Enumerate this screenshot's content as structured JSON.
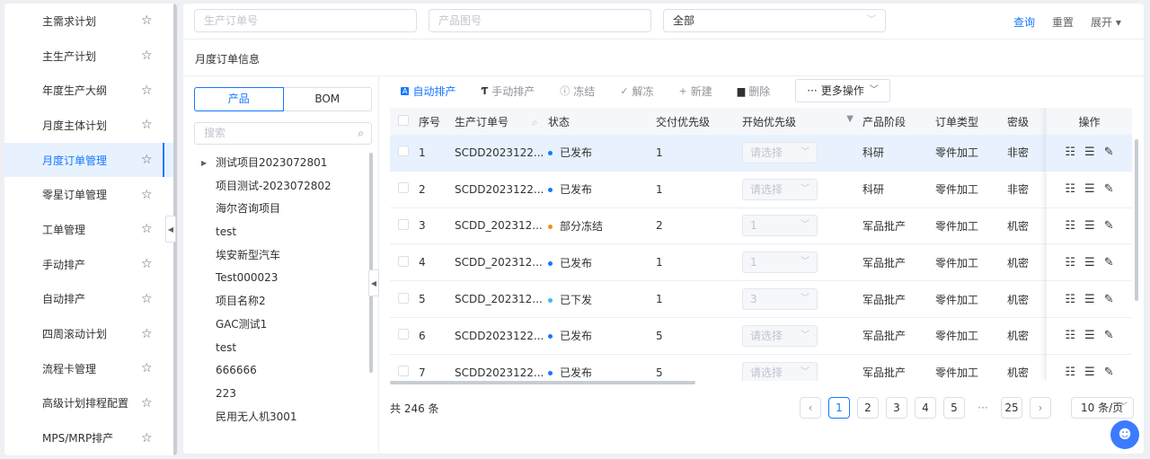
{
  "sidebar": {
    "items": [
      {
        "label": "主需求计划"
      },
      {
        "label": "主生产计划"
      },
      {
        "label": "年度生产大纲"
      },
      {
        "label": "月度主体计划"
      },
      {
        "label": "月度订单管理",
        "active": true
      },
      {
        "label": "零星订单管理"
      },
      {
        "label": "工单管理"
      },
      {
        "label": "手动排产"
      },
      {
        "label": "自动排产"
      },
      {
        "label": "四周滚动计划"
      },
      {
        "label": "流程卡管理"
      },
      {
        "label": "高级计划排程配置"
      },
      {
        "label": "MPS/MRP排产"
      }
    ],
    "star": "☆"
  },
  "filters": {
    "order_no_placeholder": "生产订单号",
    "drawing_no_placeholder": "产品图号",
    "status_select": "全部",
    "query": "查询",
    "reset": "重置",
    "expand": "展开 ▾"
  },
  "section_title": "月度订单信息",
  "tree": {
    "tabs": [
      "产品",
      "BOM"
    ],
    "search_placeholder": "搜索",
    "nodes": [
      "测试项目2023072801",
      "项目测试-2023072802",
      "海尔咨询项目",
      "test",
      "埃安新型汽车",
      "Test000023",
      "项目名称2",
      "GAC测试1",
      "test",
      "666666",
      "223",
      "民用无人机3001"
    ]
  },
  "toolbar": {
    "auto": "自动排产",
    "manual": "手动排产",
    "freeze": "冻结",
    "unfreeze": "解冻",
    "new": "新建",
    "delete": "删除",
    "more": "更多操作"
  },
  "table": {
    "headers": {
      "index": "序号",
      "order_no": "生产订单号",
      "status": "状态",
      "delivery_priority": "交付优先级",
      "start_priority": "开始优先级",
      "stage": "产品阶段",
      "order_type": "订单类型",
      "secrecy": "密级",
      "ops": "操作"
    },
    "rows": [
      {
        "index": "1",
        "order_no": "SCDD2023122...",
        "status": "已发布",
        "status_color": "#1677ff",
        "delivery": "1",
        "start": "请选择",
        "stage": "科研",
        "type": "零件加工",
        "secrecy": "非密"
      },
      {
        "index": "2",
        "order_no": "SCDD2023122...",
        "status": "已发布",
        "status_color": "#1677ff",
        "delivery": "1",
        "start": "请选择",
        "stage": "科研",
        "type": "零件加工",
        "secrecy": "非密"
      },
      {
        "index": "3",
        "order_no": "SCDD_202312...",
        "status": "部分冻结",
        "status_color": "#fa8c16",
        "delivery": "2",
        "start": "1",
        "stage": "军品批产",
        "type": "零件加工",
        "secrecy": "机密"
      },
      {
        "index": "4",
        "order_no": "SCDD_202312...",
        "status": "已发布",
        "status_color": "#1677ff",
        "delivery": "1",
        "start": "1",
        "stage": "军品批产",
        "type": "零件加工",
        "secrecy": "机密"
      },
      {
        "index": "5",
        "order_no": "SCDD_202312...",
        "status": "已下发",
        "status_color": "#4ab3f4",
        "delivery": "1",
        "start": "3",
        "stage": "军品批产",
        "type": "零件加工",
        "secrecy": "机密"
      },
      {
        "index": "6",
        "order_no": "SCDD2023122...",
        "status": "已发布",
        "status_color": "#1677ff",
        "delivery": "5",
        "start": "请选择",
        "stage": "军品批产",
        "type": "零件加工",
        "secrecy": "机密"
      },
      {
        "index": "7",
        "order_no": "SCDD2023122...",
        "status": "已发布",
        "status_color": "#1677ff",
        "delivery": "5",
        "start": "请选择",
        "stage": "军品批产",
        "type": "零件加工",
        "secrecy": "机密"
      }
    ]
  },
  "pagination": {
    "total": "共 246 条",
    "pages": [
      "1",
      "2",
      "3",
      "4",
      "5"
    ],
    "ellipsis": "···",
    "last": "25",
    "page_size": "10 条/页"
  },
  "colors": {
    "accent": "#1677ff"
  }
}
